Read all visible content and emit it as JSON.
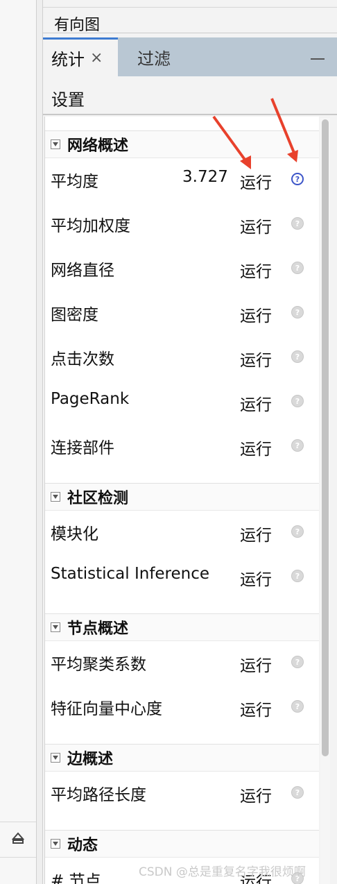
{
  "top_panel": {
    "title": "有向图"
  },
  "tabs": [
    {
      "label": "统计",
      "close_icon": "×",
      "active": true
    },
    {
      "label": "过滤",
      "active": false
    }
  ],
  "window_controls": {
    "minimize_icon": "minimize-icon"
  },
  "settings_label": "设置",
  "sections": [
    {
      "title": "网络概述",
      "items": [
        {
          "label": "平均度",
          "value": "3.727",
          "run": "运行",
          "help_active": true
        },
        {
          "label": "平均加权度",
          "value": "",
          "run": "运行",
          "help_active": false
        },
        {
          "label": "网络直径",
          "value": "",
          "run": "运行",
          "help_active": false
        },
        {
          "label": "图密度",
          "value": "",
          "run": "运行",
          "help_active": false
        },
        {
          "label": "点击次数",
          "value": "",
          "run": "运行",
          "help_active": false
        },
        {
          "label": "PageRank",
          "value": "",
          "run": "运行",
          "help_active": false
        },
        {
          "label": "连接部件",
          "value": "",
          "run": "运行",
          "help_active": false
        }
      ]
    },
    {
      "title": "社区检测",
      "items": [
        {
          "label": "模块化",
          "value": "",
          "run": "运行",
          "help_active": false
        },
        {
          "label": "Statistical Inference",
          "value": "",
          "run": "运行",
          "help_active": false
        }
      ]
    },
    {
      "title": "节点概述",
      "items": [
        {
          "label": "平均聚类系数",
          "value": "",
          "run": "运行",
          "help_active": false
        },
        {
          "label": "特征向量中心度",
          "value": "",
          "run": "运行",
          "help_active": false
        }
      ]
    },
    {
      "title": "边概述",
      "items": [
        {
          "label": "平均路径长度",
          "value": "",
          "run": "运行",
          "help_active": false
        }
      ]
    },
    {
      "title": "动态",
      "items": [
        {
          "label": "# 节点",
          "value": "",
          "run": "运行",
          "help_active": false
        }
      ]
    }
  ],
  "watermark": "CSDN @总是重复名字我很烦啊",
  "colors": {
    "accent": "#3d7bd1",
    "tabbar": "#b9c7d3",
    "annotation_arrow": "#e8412c",
    "help_active": "#3c55c8"
  }
}
